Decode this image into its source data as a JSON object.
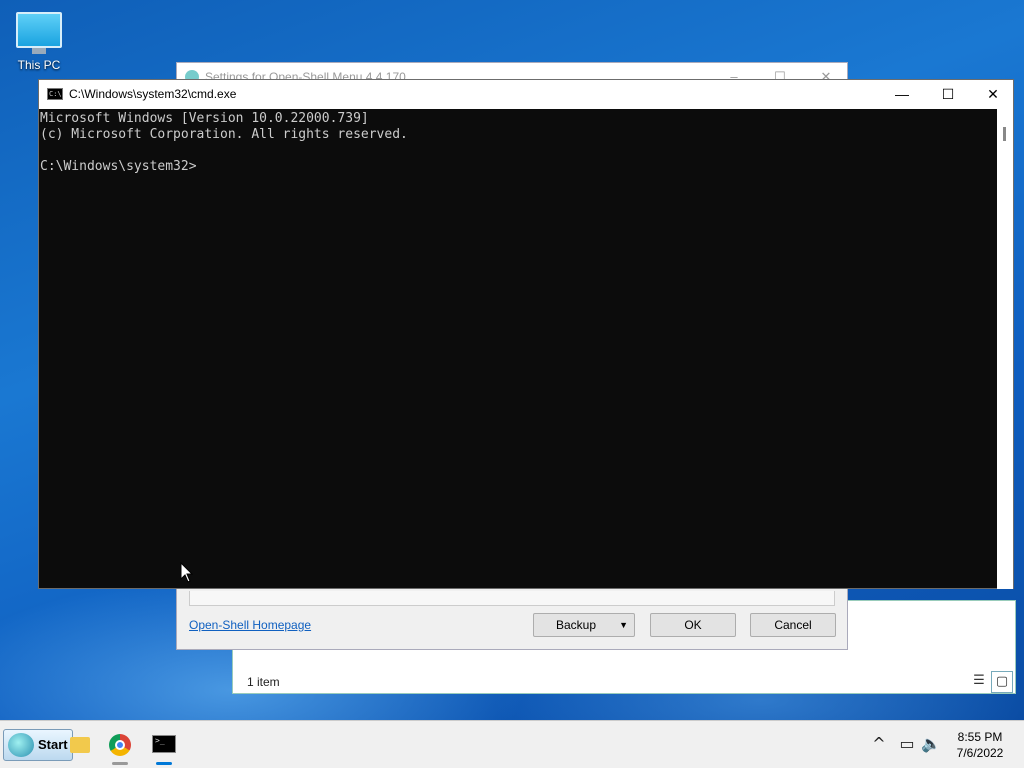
{
  "desktop": {
    "icon_label": "This PC"
  },
  "explorer": {
    "status": "1 item"
  },
  "settings": {
    "title": "Settings for Open-Shell Menu 4.4.170",
    "homepage_link": "Open-Shell Homepage",
    "backup_label": "Backup",
    "ok_label": "OK",
    "cancel_label": "Cancel"
  },
  "cmd": {
    "title": "C:\\Windows\\system32\\cmd.exe",
    "lines": [
      "Microsoft Windows [Version 10.0.22000.739]",
      "(c) Microsoft Corporation. All rights reserved.",
      "",
      "C:\\Windows\\system32>"
    ]
  },
  "taskbar": {
    "start_label": "Start",
    "time": "8:55 PM",
    "date": "7/6/2022",
    "active_color": "#0078d7"
  }
}
